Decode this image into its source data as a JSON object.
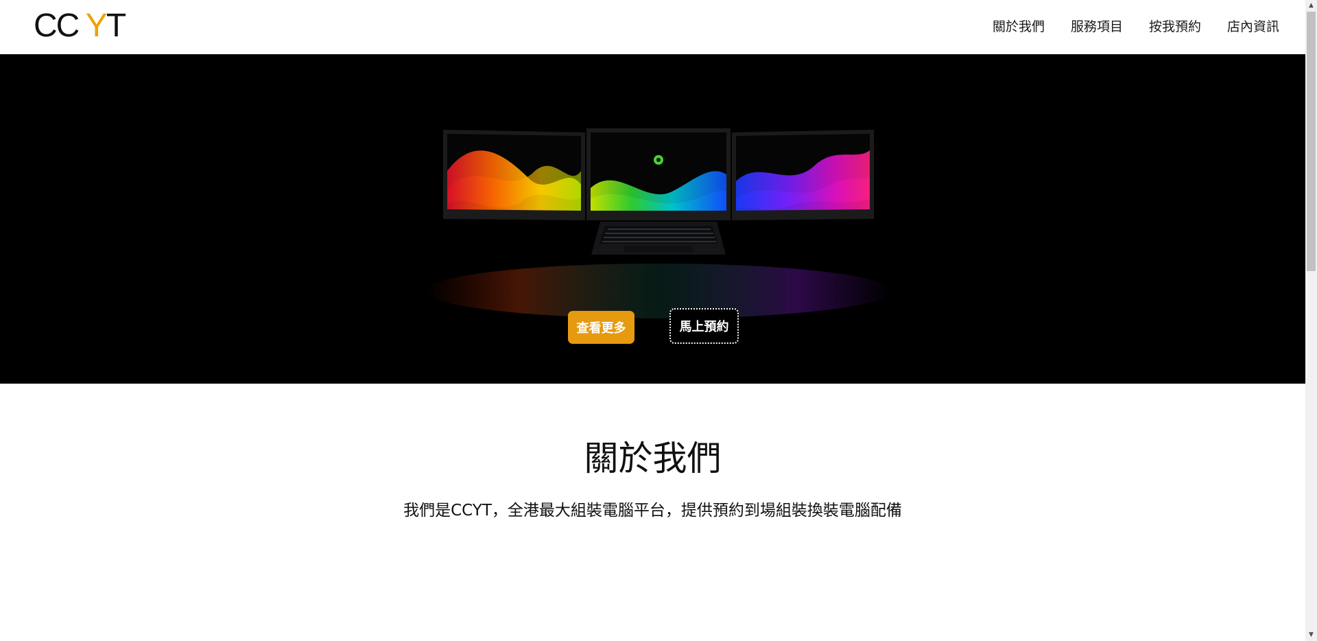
{
  "header": {
    "logo_prefix": "CC ",
    "logo_accent": "Y",
    "logo_suffix": "T",
    "nav": [
      {
        "label": "關於我們"
      },
      {
        "label": "服務項目"
      },
      {
        "label": "按我預約"
      },
      {
        "label": "店內資訊"
      }
    ]
  },
  "hero": {
    "image": "triple-screen-laptop",
    "more_button": "查看更多",
    "book_button": "馬上預約"
  },
  "about": {
    "title": "關於我們",
    "text": "我們是CCYT，全港最大組裝電腦平台，提供預約到場組裝換裝電腦配備"
  },
  "colors": {
    "accent": "#f0a000",
    "button": "#e69a10",
    "hero_background": "#000000"
  }
}
